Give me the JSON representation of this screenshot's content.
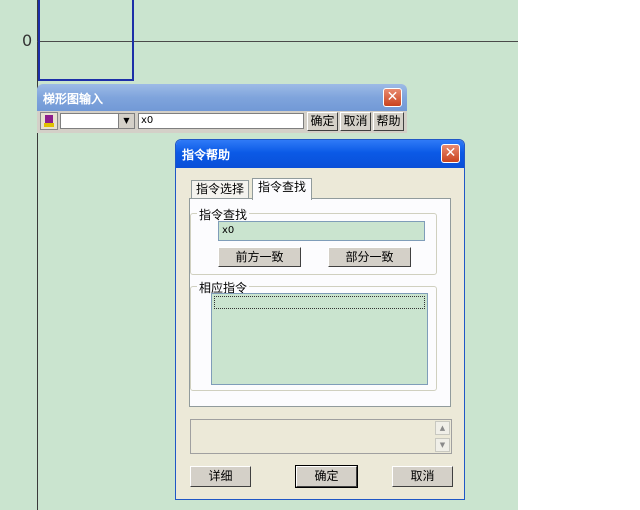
{
  "ladder": {
    "step_number": "0"
  },
  "toolbar": {
    "title": "梯形图输入",
    "close_glyph": "✕",
    "combo_arrow": "▼",
    "input_value": "x0",
    "ok_label": "确定",
    "cancel_label": "取消",
    "help_label": "帮助"
  },
  "dialog": {
    "title": "指令帮助",
    "close_glyph": "✕",
    "tabs": [
      {
        "label": "指令选择"
      },
      {
        "label": "指令查找"
      }
    ],
    "find_group": {
      "label": "指令查找",
      "input_value": "x0",
      "prefix_match_label": "前方一致",
      "partial_match_label": "部分一致"
    },
    "result_group": {
      "label": "相应指令"
    },
    "scroll_up_glyph": "▲",
    "scroll_down_glyph": "▼",
    "detail_label": "详细",
    "ok_label": "确定",
    "cancel_label": "取消"
  },
  "colors": {
    "ladder_background": "#cae4cf",
    "cursor_border": "#1c2fa8",
    "dialog_title": "#0b5ae6",
    "toolbar_title": "#7fa4dc",
    "close_button": "#c9431e"
  }
}
